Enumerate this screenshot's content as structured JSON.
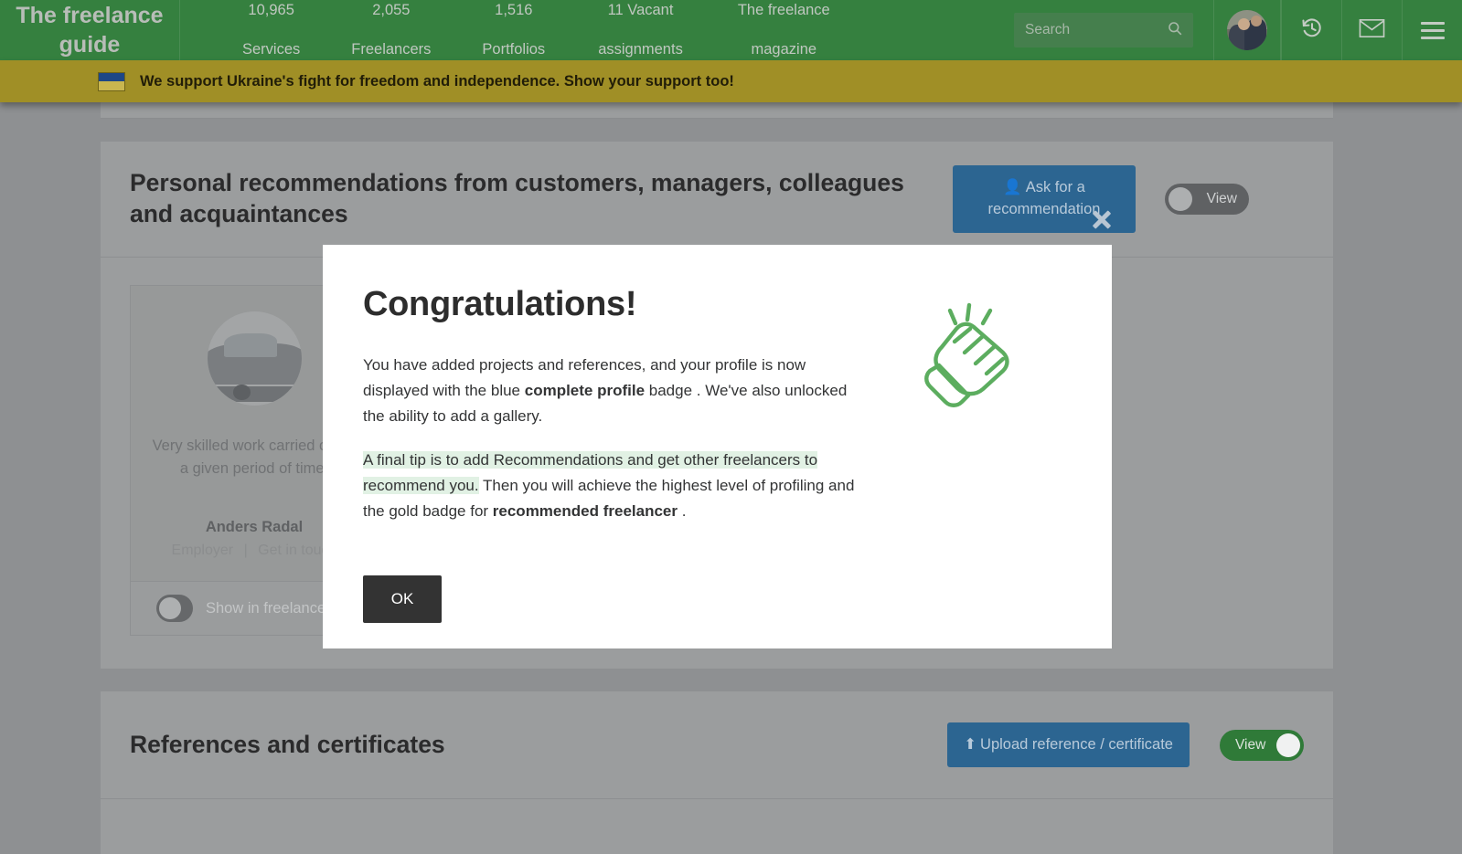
{
  "header": {
    "brand": "The freelance\nguide",
    "nav": [
      {
        "count": "10,965",
        "label": "Services"
      },
      {
        "count": "2,055",
        "label": "Freelancers"
      },
      {
        "count": "1,516",
        "label": "Portfolios"
      },
      {
        "count": "11 Vacant",
        "label": "assignments"
      },
      {
        "count": "The freelance",
        "label": "magazine"
      }
    ],
    "search_placeholder": "Search",
    "icons": [
      "avatar",
      "history-icon",
      "envelope-icon",
      "hamburger-menu-icon"
    ]
  },
  "ukraine_banner": {
    "text": "We support Ukraine's fight for freedom and independence. Show your support too!",
    "flag_alt": "ukraine-flag",
    "bg": "#a08f26"
  },
  "sections": [
    {
      "title": "Personal recommendations from customers, managers, colleagues and acquaintances",
      "action_label": "Ask for a recommendation",
      "action_icon": "user-icon",
      "toggle_label": "View",
      "toggle_state": "off"
    },
    {
      "title": "References and certificates",
      "action_label": "Upload reference / certificate",
      "action_icon": "upload-icon",
      "toggle_label": "View",
      "toggle_state": "on"
    }
  ],
  "testimonial": {
    "text": "Very skilled work carried out in a given period of time.",
    "name": "Anders Radal",
    "role": "Employer",
    "separator": "|",
    "contact": "Get in touch",
    "footer_toggle_label": "Show in freelancer profile",
    "footer_toggle_state": "off",
    "avatar_alt": "car-photo-avatar"
  },
  "modal": {
    "title": "Congratulations!",
    "paragraph1": {
      "a": "You have added projects and references, and your profile is now displayed with the blue ",
      "bold": "complete profile",
      "b": " badge . We've also unlocked the ability to add a gallery."
    },
    "paragraph2": {
      "highlight": "A final tip is to add Recommendations and get other freelancers to recommend you.",
      "mid": " Then you will achieve the highest level of profiling and the gold badge for ",
      "bold": "recommended freelancer",
      "end": " ."
    },
    "ok_label": "OK",
    "illustration": "clapping-hands-icon",
    "illustration_color": "#5cad5f",
    "highlight_color": "#e1f1e4"
  },
  "close_button": {
    "icon": "close-icon"
  }
}
